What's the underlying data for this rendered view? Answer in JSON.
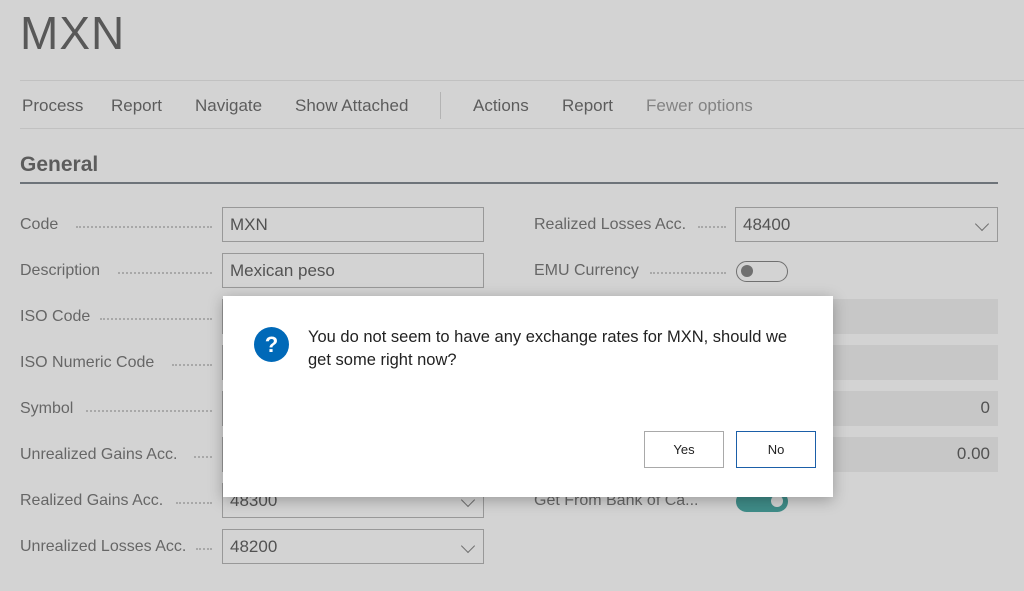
{
  "page": {
    "title": "MXN"
  },
  "actionbar": {
    "items": [
      "Process",
      "Report",
      "Navigate",
      "Show Attached",
      "Actions",
      "Report",
      "Fewer options"
    ]
  },
  "general": {
    "section_title": "General",
    "code": {
      "label": "Code",
      "value": "MXN"
    },
    "description": {
      "label": "Description",
      "value": "Mexican peso"
    },
    "iso_code": {
      "label": "ISO Code",
      "value": ""
    },
    "iso_numeric_code": {
      "label": "ISO Numeric Code",
      "value": ""
    },
    "symbol": {
      "label": "Symbol",
      "value": ""
    },
    "unrealized_gains_acc": {
      "label": "Unrealized Gains Acc.",
      "value": ""
    },
    "realized_gains_acc": {
      "label": "Realized Gains Acc.",
      "value": "48300"
    },
    "unrealized_losses_acc": {
      "label": "Unrealized Losses Acc.",
      "value": "48200"
    },
    "realized_losses_acc": {
      "label": "Realized Losses Acc.",
      "value": "48400"
    },
    "emu_currency": {
      "label": "EMU Currency",
      "on": false
    },
    "right_field_3": {
      "value": ""
    },
    "right_field_4": {
      "value": ""
    },
    "right_field_5": {
      "value": "0"
    },
    "right_field_6": {
      "value": "0.00"
    },
    "get_from_bank": {
      "label": "Get From Bank of Ca...",
      "on": true
    }
  },
  "dialog": {
    "message": "You do not seem to have any exchange rates for MXN, should we get some right now?",
    "icon": "question-icon",
    "yes_label": "Yes",
    "no_label": "No"
  },
  "colors": {
    "accent": "#0069b8",
    "toggle_on": "#00857e",
    "overlay": "rgba(150,150,150,0.42)"
  }
}
